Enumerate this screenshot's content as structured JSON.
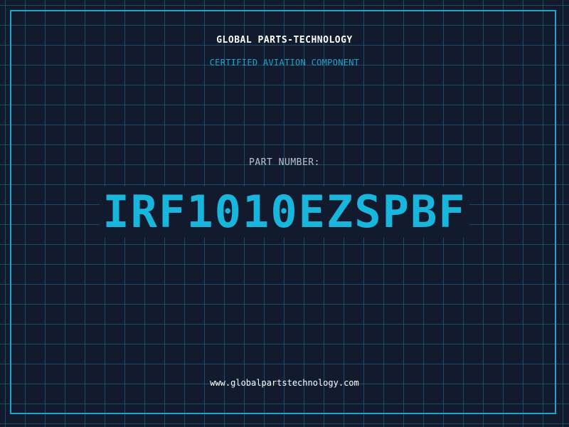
{
  "header": {
    "company": "GLOBAL PARTS-TECHNOLOGY",
    "tagline": "CERTIFIED AVIATION COMPONENT"
  },
  "part": {
    "label": "PART NUMBER:",
    "number": "IRF1010EZSPBF"
  },
  "footer": {
    "website": "www.globalpartstechnology.com"
  },
  "colors": {
    "background": "#121a2e",
    "accent": "#1ba7cc",
    "part_number": "#18b6dc",
    "text_primary": "#ffffff",
    "text_secondary": "#b9c3cf"
  }
}
